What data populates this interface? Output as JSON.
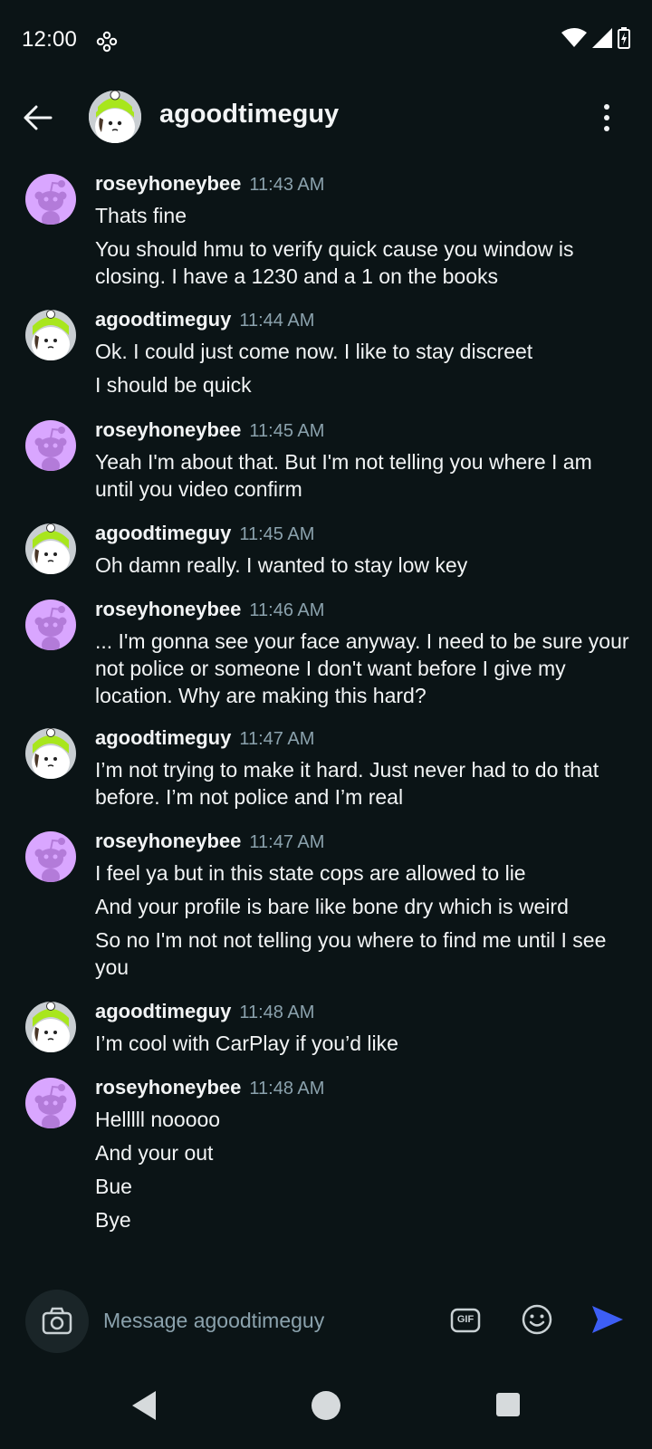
{
  "status_bar": {
    "time": "12:00",
    "icons": [
      "notification-dots-icon",
      "wifi-icon",
      "cellular-icon",
      "battery-charging-icon"
    ]
  },
  "header": {
    "title": "agoodtimeguy",
    "back_icon": "arrow-left-icon",
    "more_icon": "more-vertical-icon"
  },
  "messages": [
    {
      "author": "roseyhoneybee",
      "time": "11:43 AM",
      "avatar": "snoo-purple",
      "lines": [
        "Thats fine",
        "You should hmu to verify quick cause you window is closing. I have a 1230 and a 1 on the books"
      ]
    },
    {
      "author": "agoodtimeguy",
      "time": "11:44 AM",
      "avatar": "snoo-green-beanie",
      "lines": [
        "Ok. I could just come now. I like to stay discreet",
        "I should be quick"
      ]
    },
    {
      "author": "roseyhoneybee",
      "time": "11:45 AM",
      "avatar": "snoo-purple",
      "lines": [
        "Yeah I'm about that. But I'm not telling you where I am until you video confirm"
      ]
    },
    {
      "author": "agoodtimeguy",
      "time": "11:45 AM",
      "avatar": "snoo-green-beanie",
      "lines": [
        "Oh damn really. I wanted to stay low key"
      ]
    },
    {
      "author": "roseyhoneybee",
      "time": "11:46 AM",
      "avatar": "snoo-purple",
      "lines": [
        "... I'm gonna see your face anyway. I need to be sure your not police or someone I don't want before I give my location. Why are making this hard?"
      ]
    },
    {
      "author": "agoodtimeguy",
      "time": "11:47 AM",
      "avatar": "snoo-green-beanie",
      "lines": [
        "I’m not trying to make it hard. Just never had to do that before. I’m not police and I’m real"
      ]
    },
    {
      "author": "roseyhoneybee",
      "time": "11:47 AM",
      "avatar": "snoo-purple",
      "lines": [
        "I feel ya but in this state cops are allowed to lie",
        "And your profile is bare like bone dry which is weird",
        "So no I'm not not telling you where to find me until I see you"
      ]
    },
    {
      "author": "agoodtimeguy",
      "time": "11:48 AM",
      "avatar": "snoo-green-beanie",
      "lines": [
        "I’m cool with CarPlay if you’d like"
      ]
    },
    {
      "author": "roseyhoneybee",
      "time": "11:48 AM",
      "avatar": "snoo-purple",
      "lines": [
        "Helllll nooooo",
        "And your out",
        "Bue",
        "Bye"
      ]
    }
  ],
  "composer": {
    "placeholder": "Message agoodtimeguy",
    "gif_label": "GIF",
    "icons": [
      "camera-icon",
      "gif-icon",
      "emoji-icon",
      "send-icon"
    ]
  },
  "nav_bar": {
    "icons": [
      "nav-back-icon",
      "nav-home-icon",
      "nav-recents-icon"
    ]
  },
  "colors": {
    "background": "#0b1416",
    "text": "#f2f4f5",
    "muted": "#8ba2ad",
    "send": "#3d5ef5",
    "avatar_purple": "#d9a6ff",
    "avatar_green": "#a8e61d"
  }
}
